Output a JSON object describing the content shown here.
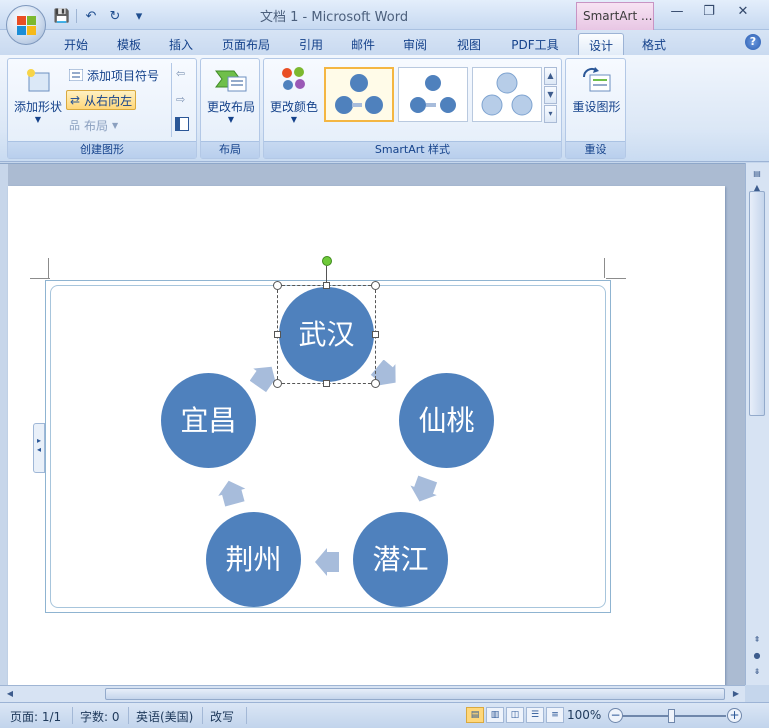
{
  "window": {
    "title": "文档 1 - Microsoft Word",
    "context_tab_title": "SmartArt ...",
    "minimize": "—",
    "restore": "❐",
    "close": "✕"
  },
  "qat": {
    "save": "💾",
    "undo": "↶",
    "redo": "↻",
    "customize": "▾"
  },
  "tabs": [
    {
      "label": "开始"
    },
    {
      "label": "模板"
    },
    {
      "label": "插入"
    },
    {
      "label": "页面布局"
    },
    {
      "label": "引用"
    },
    {
      "label": "邮件"
    },
    {
      "label": "审阅"
    },
    {
      "label": "视图"
    },
    {
      "label": "PDF工具"
    },
    {
      "label": "设计"
    },
    {
      "label": "格式"
    }
  ],
  "active_tab": "设计",
  "help": "?",
  "ribbon": {
    "create_group": {
      "label": "创建图形",
      "add_shape": "添加形状",
      "add_bullet": "添加项目符号",
      "right_to_left": "从右向左",
      "layout": "布局"
    },
    "layout_group": {
      "label": "布局",
      "change_layout": "更改布局"
    },
    "styles_group": {
      "label": "SmartArt 样式",
      "change_colors": "更改颜色"
    },
    "reset_group": {
      "label": "重设",
      "reset_graphic": "重设图形"
    }
  },
  "smartart": {
    "nodes": [
      "武汉",
      "仙桃",
      "潜江",
      "荆州",
      "宜昌"
    ],
    "fill_color": "#4f81bd",
    "arrow_color": "#a7bcdb"
  },
  "statusbar": {
    "page": "页面: 1/1",
    "words": "字数: 0",
    "language": "英语(美国)",
    "mode": "改写",
    "zoom": "100%"
  },
  "colors": {
    "accent": "#15428b",
    "selected_gallery": "#f4b642"
  }
}
